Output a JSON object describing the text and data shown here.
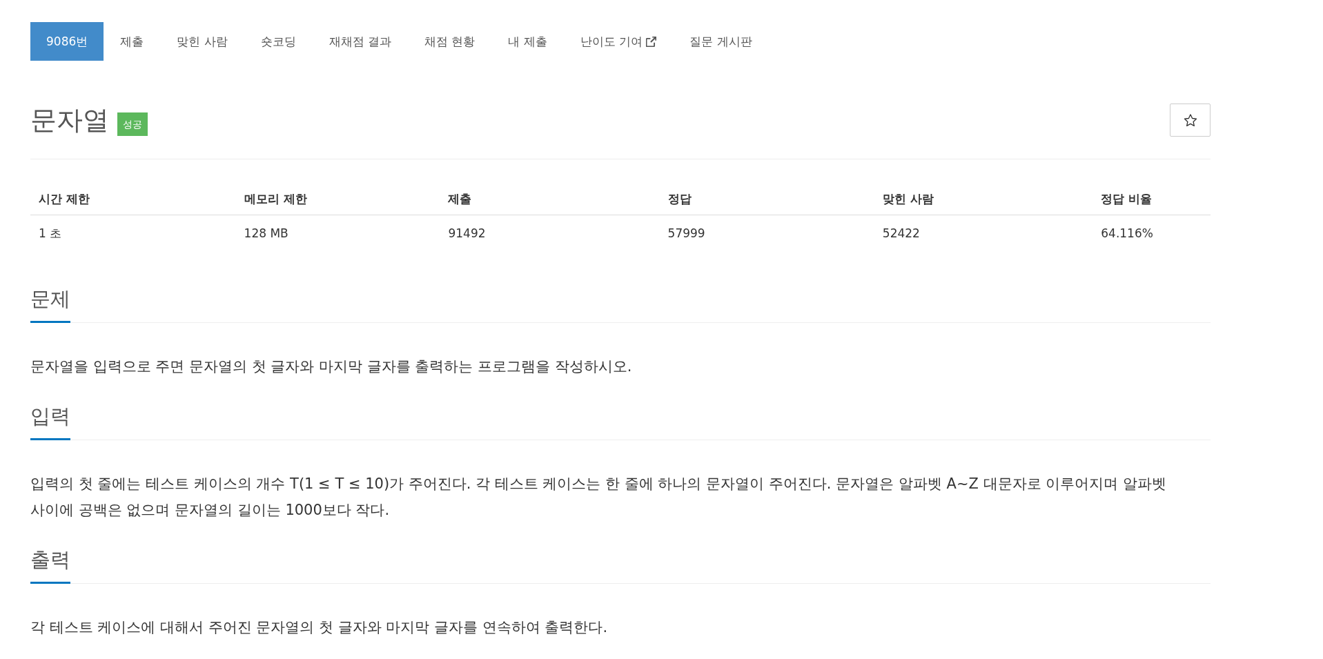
{
  "tabs": [
    {
      "label": "9086번",
      "selected": true,
      "external": false
    },
    {
      "label": "제출",
      "selected": false,
      "external": false
    },
    {
      "label": "맞힌 사람",
      "selected": false,
      "external": false
    },
    {
      "label": "숏코딩",
      "selected": false,
      "external": false
    },
    {
      "label": "재채점 결과",
      "selected": false,
      "external": false
    },
    {
      "label": "채점 현황",
      "selected": false,
      "external": false
    },
    {
      "label": "내 제출",
      "selected": false,
      "external": false
    },
    {
      "label": "난이도 기여",
      "selected": false,
      "external": true
    },
    {
      "label": "질문 게시판",
      "selected": false,
      "external": false
    }
  ],
  "problem": {
    "title": "문자열",
    "status_badge": "성공",
    "starred": false
  },
  "limits_table": {
    "columns": [
      "시간 제한",
      "메모리 제한",
      "제출",
      "정답",
      "맞힌 사람",
      "정답 비율"
    ],
    "rows": [
      [
        "1 초",
        "128 MB",
        "91492",
        "57999",
        "52422",
        "64.116%"
      ]
    ]
  },
  "sections": [
    {
      "heading": "문제",
      "paragraphs": [
        "문자열을 입력으로 주면 문자열의 첫 글자와 마지막 글자를 출력하는 프로그램을 작성하시오."
      ]
    },
    {
      "heading": "입력",
      "paragraphs": [
        "입력의 첫 줄에는 테스트 케이스의 개수 T(1 ≤ T ≤ 10)가 주어진다. 각 테스트 케이스는 한 줄에 하나의 문자열이 주어진다. 문자열은 알파벳 A~Z 대문자로 이루어지며 알파벳 사이에 공백은 없으며 문자열의 길이는 1000보다 작다."
      ]
    },
    {
      "heading": "출력",
      "paragraphs": [
        "각 테스트 케이스에 대해서 주어진 문자열의 첫 글자와 마지막 글자를 연속하여 출력한다."
      ]
    }
  ]
}
